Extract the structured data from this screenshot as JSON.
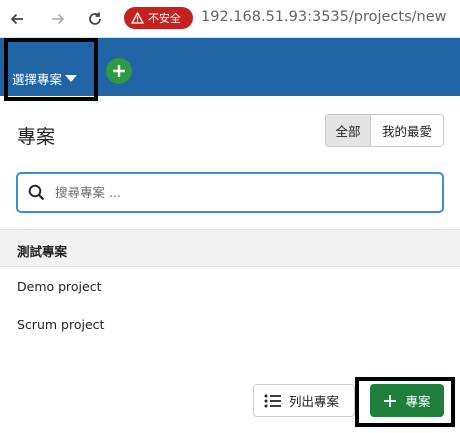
{
  "browser": {
    "security_label": "不安全",
    "url": "192.168.51.93:3535/projects/new"
  },
  "appbar": {
    "project_selector_label": "選擇專案"
  },
  "panel": {
    "title": "專案",
    "filters": [
      "全部",
      "我的最愛"
    ],
    "active_filter": "全部",
    "search_placeholder": "搜尋專案 ...",
    "section_label": "測試專案",
    "projects": [
      "Demo project",
      "Scrum project"
    ]
  },
  "actions": {
    "list_projects_label": "列出專案",
    "new_project_label": "專案"
  },
  "colors": {
    "header_blue": "#1f65a6",
    "add_green": "#2f9a42",
    "primary_green": "#1e7e3a",
    "insecure_red": "#c5221f",
    "focus_blue": "#3b8ed6"
  }
}
